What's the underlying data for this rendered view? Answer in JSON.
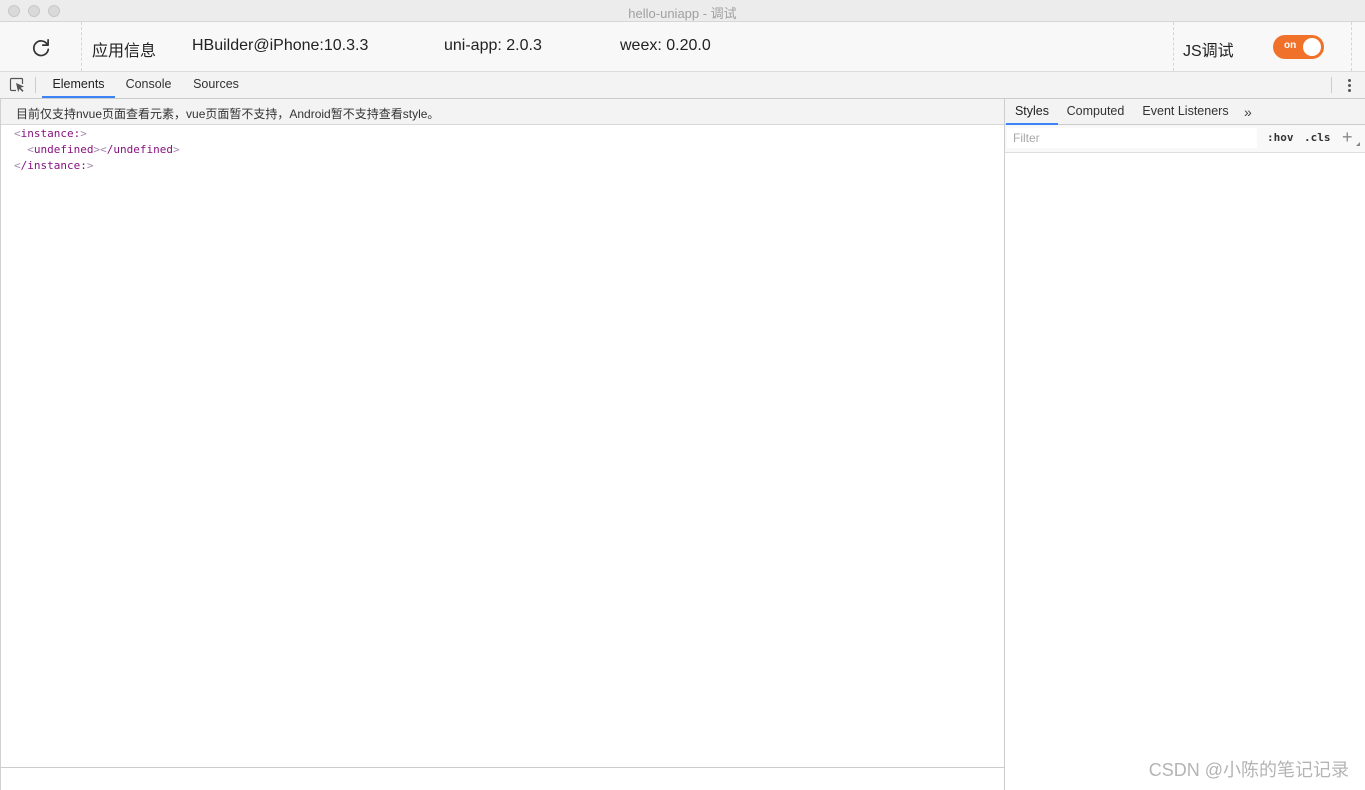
{
  "window": {
    "title": "hello-uniapp - 调试"
  },
  "info_bar": {
    "refresh_icon": "refresh-icon",
    "app_info_label": "应用信息",
    "device": "HBuilder@iPhone:10.3.3",
    "uni_app_version": "uni-app: 2.0.3",
    "weex_version": "weex: 0.20.0",
    "js_debug_label": "JS调试",
    "js_debug_toggle": {
      "state": "on",
      "label": "on",
      "color": "#f0712a"
    }
  },
  "devtools": {
    "inspect_icon": "inspect-element-icon",
    "tabs": [
      {
        "label": "Elements",
        "active": true
      },
      {
        "label": "Console",
        "active": false
      },
      {
        "label": "Sources",
        "active": false
      }
    ],
    "menu_icon": "more-vertical-icon",
    "accent_color": "#3e82f7"
  },
  "elements_panel": {
    "notice": "目前仅支持nvue页面查看元素，vue页面暂不支持，Android暂不支持查看style。",
    "dom_tree": {
      "root_open": "instance:",
      "child_open": "undefined",
      "child_close": "/undefined",
      "root_close": "/instance:"
    }
  },
  "styles_panel": {
    "tabs": [
      {
        "label": "Styles",
        "active": true
      },
      {
        "label": "Computed",
        "active": false
      },
      {
        "label": "Event Listeners",
        "active": false
      }
    ],
    "more_tabs_glyph": "»",
    "filter_placeholder": "Filter",
    "hov_label": ":hov",
    "cls_label": ".cls",
    "add_rule_glyph": "+"
  },
  "watermark": "CSDN @小陈的笔记记录"
}
